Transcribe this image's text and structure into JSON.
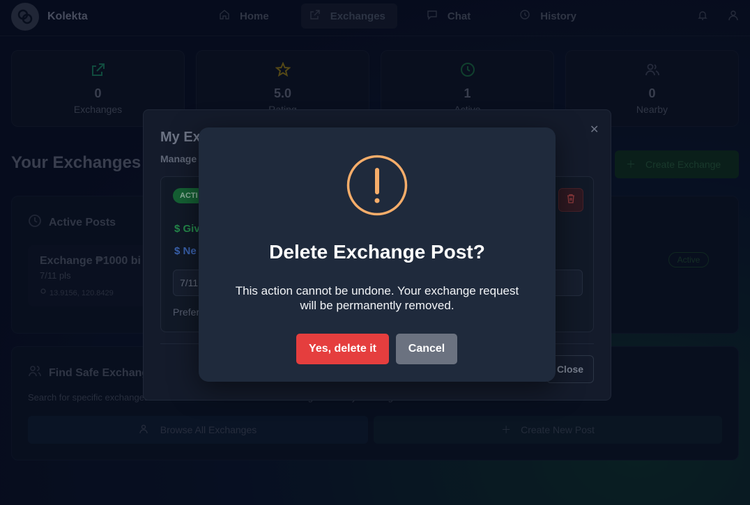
{
  "app": {
    "name": "Kolekta"
  },
  "nav": {
    "items": [
      {
        "label": "Home",
        "icon": "home-icon"
      },
      {
        "label": "Exchanges",
        "icon": "external-link-icon",
        "active": true
      },
      {
        "label": "Chat",
        "icon": "chat-icon"
      },
      {
        "label": "History",
        "icon": "history-icon"
      }
    ]
  },
  "stats": [
    {
      "value": "0",
      "label": "Exchanges",
      "icon": "external-link-icon",
      "color": "#1f8f6a"
    },
    {
      "value": "5.0",
      "label": "Rating",
      "icon": "star-icon",
      "color": "#a58a1c"
    },
    {
      "value": "1",
      "label": "Active",
      "icon": "clock-icon",
      "color": "#1f7a4a"
    },
    {
      "value": "0",
      "label": "Nearby",
      "icon": "users-icon",
      "color": "#4a5266"
    }
  ],
  "main": {
    "title": "Your Exchanges",
    "create_button": "Create Exchange",
    "active_posts": {
      "heading": "Active Posts",
      "post": {
        "title": "Exchange ₱1000 bi",
        "subtitle": "7/11 pls",
        "location": "13.9156, 120.8429",
        "status": "Active"
      }
    },
    "find": {
      "heading": "Find Safe Exchang",
      "description": "Search for specific exchanges with advanced filters available or waiting for nearby exchanges",
      "browse_button": "Browse All Exchanges",
      "new_post_button": "Create New Post"
    }
  },
  "dialog": {
    "title": "My Ex",
    "subtitle": "Manage",
    "card": {
      "badge": "ACTI",
      "give": "Giv",
      "need": "Ne",
      "input_value": "7/11",
      "preference": "Prefer"
    },
    "close_button": "Close"
  },
  "confirm": {
    "title": "Delete Exchange Post?",
    "message": "This action cannot be undone. Your exchange request will be permanently removed.",
    "confirm_button": "Yes, delete it",
    "cancel_button": "Cancel",
    "warning_color": "#f6ad6a",
    "danger_color": "#e53e3e"
  }
}
